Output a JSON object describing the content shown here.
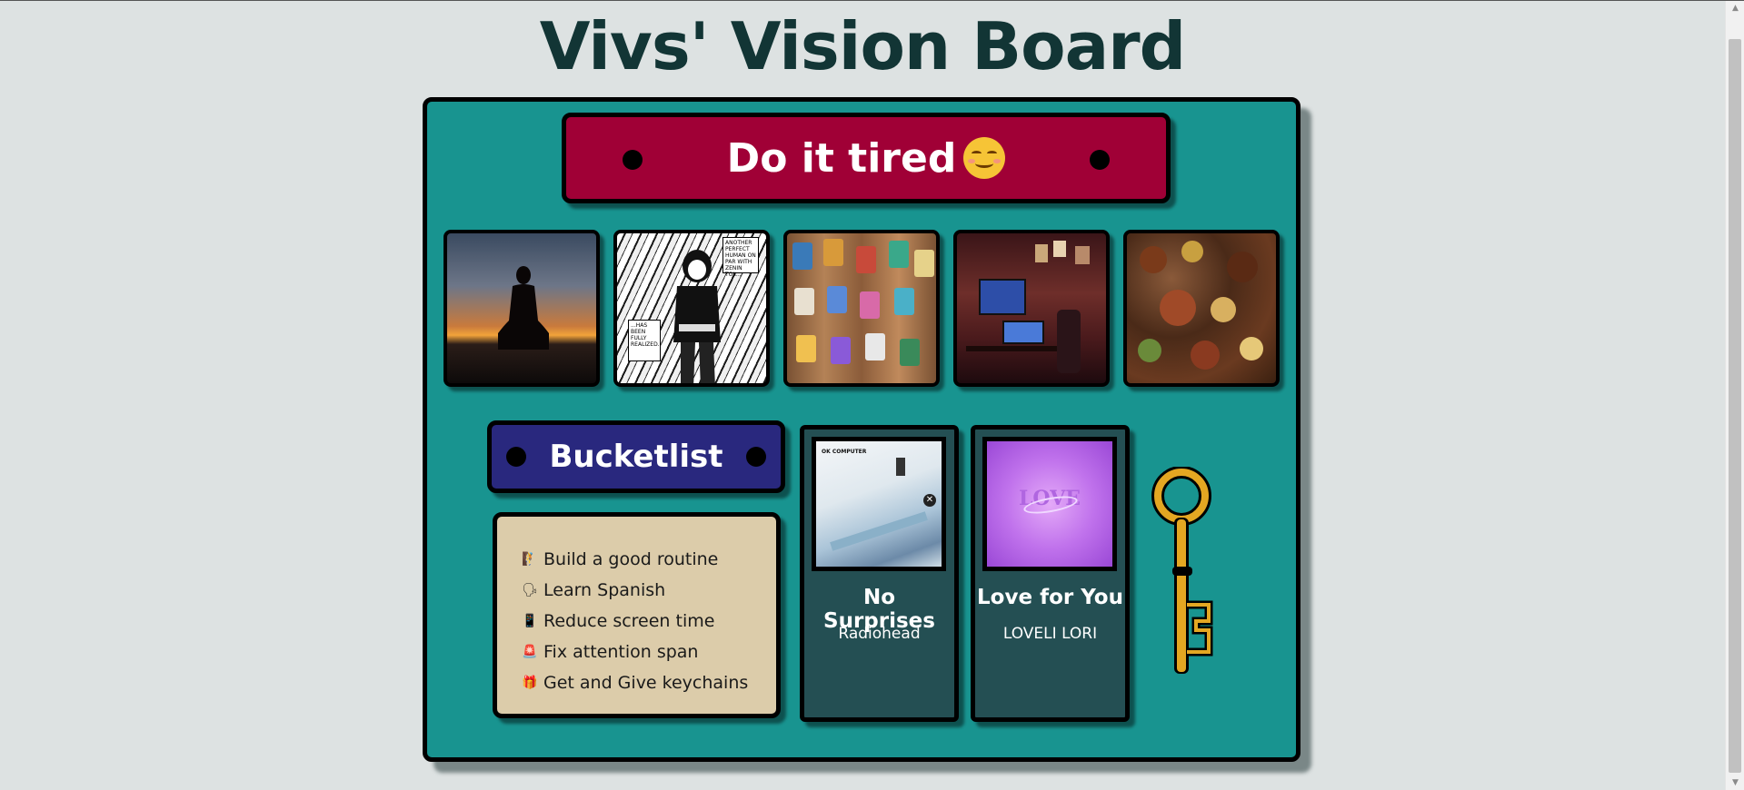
{
  "page": {
    "title": "Vivs' Vision Board"
  },
  "banner": {
    "text": "Do it tired",
    "emoji": "smiling-face-with-smiling-eyes"
  },
  "photos": [
    {
      "subject": "meditation-silhouette-sunset"
    },
    {
      "subject": "manga-panel"
    },
    {
      "subject": "mug-collection"
    },
    {
      "subject": "desk-setup"
    },
    {
      "subject": "food-spread"
    }
  ],
  "manga": {
    "bubble_top": "ANOTHER PERFECT HUMAN ON PAR WITH ZENIN TOJI...",
    "bubble_bottom": "...HAS BEEN FULLY REALIZED."
  },
  "bucketlist": {
    "title": "Bucketlist",
    "items": [
      {
        "emoji": "🧗",
        "text": "Build a good routine"
      },
      {
        "emoji": "🗣",
        "text": "Learn Spanish"
      },
      {
        "emoji": "📱",
        "text": "Reduce screen time"
      },
      {
        "emoji": "🚨",
        "text": "Fix attention span"
      },
      {
        "emoji": "🎁",
        "text": "Get and Give keychains"
      }
    ]
  },
  "songs": [
    {
      "title": "No Surprises",
      "artist": "Radiohead",
      "cover_text": "OK COMPUTER"
    },
    {
      "title": "Love for You",
      "artist": "LOVELI LORI",
      "cover_text": "LOVE"
    }
  ],
  "colors": {
    "background": "#dde2e2",
    "board": "#189490",
    "banner": "#a00036",
    "bucket_tag": "#29287e",
    "bucket_list": "#dcccaa",
    "song_card": "#244f53",
    "title": "#123535",
    "key": "#e4a722"
  }
}
